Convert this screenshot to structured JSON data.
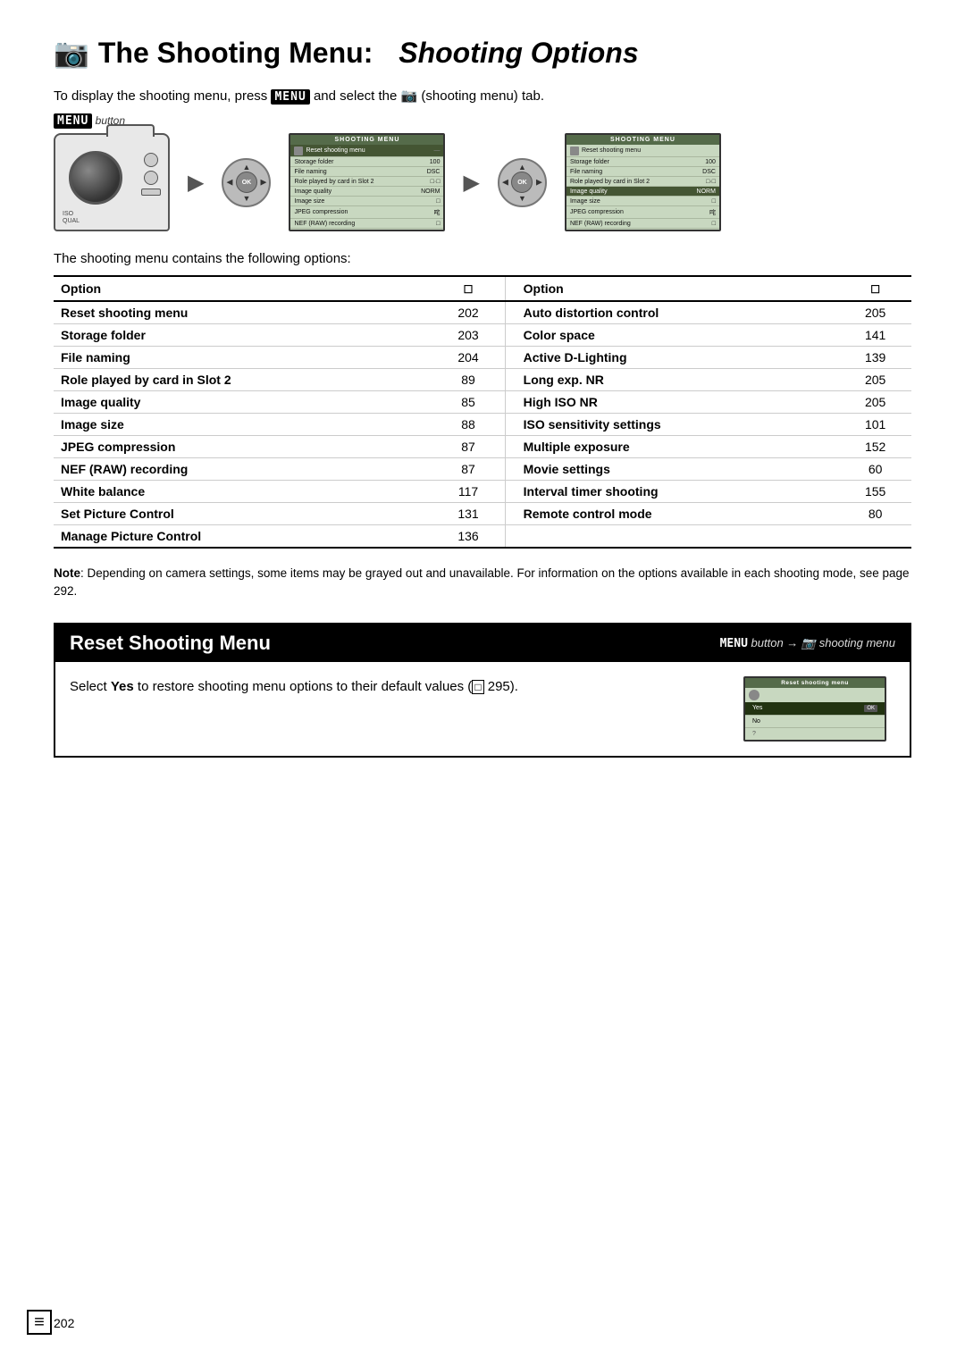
{
  "page": {
    "number": "202",
    "title_prefix": "The Shooting Menu:",
    "title_suffix": "Shooting Options",
    "camera_icon": "📷",
    "intro": {
      "text": "To display the shooting menu, press",
      "menu_key": "MENU",
      "text2": "and select the",
      "icon_symbol": "📷",
      "text3": "(shooting menu) tab."
    },
    "menu_button_label": "button",
    "options_intro": "The shooting menu contains the following options:",
    "note": {
      "label": "Note",
      "text": ": Depending on camera settings, some items may be grayed out and unavailable.  For information on the options available in each shooting mode, see page 292."
    }
  },
  "shooting_menu_screen": {
    "title": "SHOOTING MENU",
    "rows": [
      {
        "label": "Reset shooting menu",
        "value": "—",
        "highlighted": true
      },
      {
        "label": "Storage folder",
        "value": "100"
      },
      {
        "label": "File naming",
        "value": "DSC"
      },
      {
        "label": "Role played by card in Slot 2",
        "value": "□·□"
      },
      {
        "label": "Image quality",
        "value": "NORM"
      },
      {
        "label": "Image size",
        "value": "□"
      },
      {
        "label": "JPEG compression",
        "value": "咤"
      },
      {
        "label": "NEF (RAW) recording",
        "value": "□"
      }
    ]
  },
  "options_table": {
    "col1_header": "Option",
    "col1_page_header": "☐",
    "col2_header": "Option",
    "col2_page_header": "☐",
    "left_rows": [
      {
        "option": "Reset shooting menu",
        "page": "202"
      },
      {
        "option": "Storage folder",
        "page": "203"
      },
      {
        "option": "File naming",
        "page": "204"
      },
      {
        "option": "Role played by card in Slot 2",
        "page": "89"
      },
      {
        "option": "Image quality",
        "page": "85"
      },
      {
        "option": "Image size",
        "page": "88"
      },
      {
        "option": "JPEG compression",
        "page": "87"
      },
      {
        "option": "NEF (RAW) recording",
        "page": "87"
      },
      {
        "option": "White balance",
        "page": "117"
      },
      {
        "option": "Set Picture Control",
        "page": "131"
      },
      {
        "option": "Manage Picture Control",
        "page": "136"
      }
    ],
    "right_rows": [
      {
        "option": "Auto distortion control",
        "page": "205"
      },
      {
        "option": "Color space",
        "page": "141"
      },
      {
        "option": "Active D-Lighting",
        "page": "139"
      },
      {
        "option": "Long exp. NR",
        "page": "205"
      },
      {
        "option": "High ISO NR",
        "page": "205"
      },
      {
        "option": "ISO sensitivity settings",
        "page": "101"
      },
      {
        "option": "Multiple exposure",
        "page": "152"
      },
      {
        "option": "Movie settings",
        "page": "60"
      },
      {
        "option": "Interval timer shooting",
        "page": "155"
      },
      {
        "option": "Remote control mode",
        "page": "80"
      }
    ]
  },
  "reset_section": {
    "heading": "Reset Shooting Menu",
    "menu_path_prefix": "MENU",
    "menu_path_text": "button → 📷 shooting menu",
    "body": "Select",
    "yes_word": "Yes",
    "body2": "to restore shooting menu options to their default values (",
    "page_ref": "□",
    "page_num": "295",
    "body3": ").",
    "screen": {
      "title": "Reset shooting menu",
      "icon": "📷",
      "yes_label": "Yes",
      "no_label": "No"
    }
  },
  "bottom": {
    "page_number": "202",
    "icon": "≡"
  }
}
